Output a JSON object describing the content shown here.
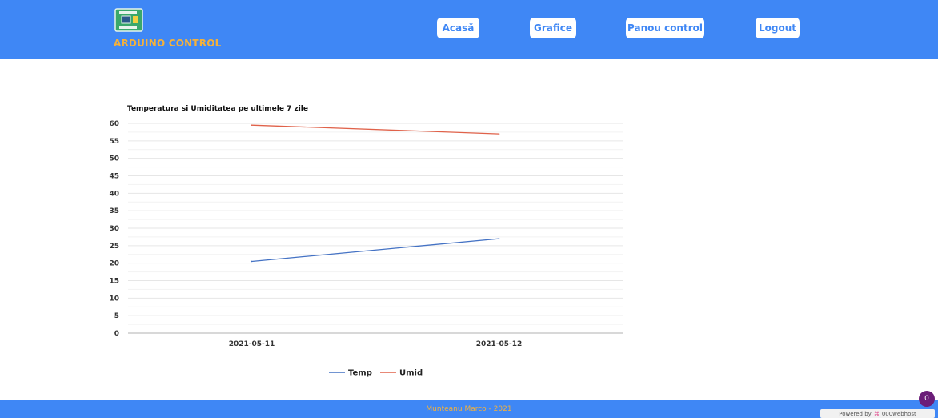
{
  "header": {
    "brand": "ARDUINO CONTROL",
    "nav": [
      "Acasă",
      "Grafice",
      "Panou control",
      "Logout"
    ]
  },
  "footer": {
    "text": "Munteanu Marco - 2021",
    "badge_count": "0",
    "powered_label": "Powered by",
    "powered_host": "000webhost"
  },
  "colors": {
    "header_bg": "#3f87f5",
    "brand_text": "#f4b13b",
    "temp_line": "#4472c4",
    "umid_line": "#e0624a"
  },
  "chart_data": {
    "type": "line",
    "title": "Temperatura si Umiditatea pe ultimele 7 zile",
    "categories": [
      "2021-05-11",
      "2021-05-12"
    ],
    "series": [
      {
        "name": "Temp",
        "values": [
          20.5,
          27
        ]
      },
      {
        "name": "Umid",
        "values": [
          59.5,
          57
        ]
      }
    ],
    "yticks": [
      0,
      5,
      10,
      15,
      20,
      25,
      30,
      35,
      40,
      45,
      50,
      55,
      60
    ],
    "ylim": [
      0,
      60
    ],
    "grid": true,
    "legend": "bottom"
  }
}
